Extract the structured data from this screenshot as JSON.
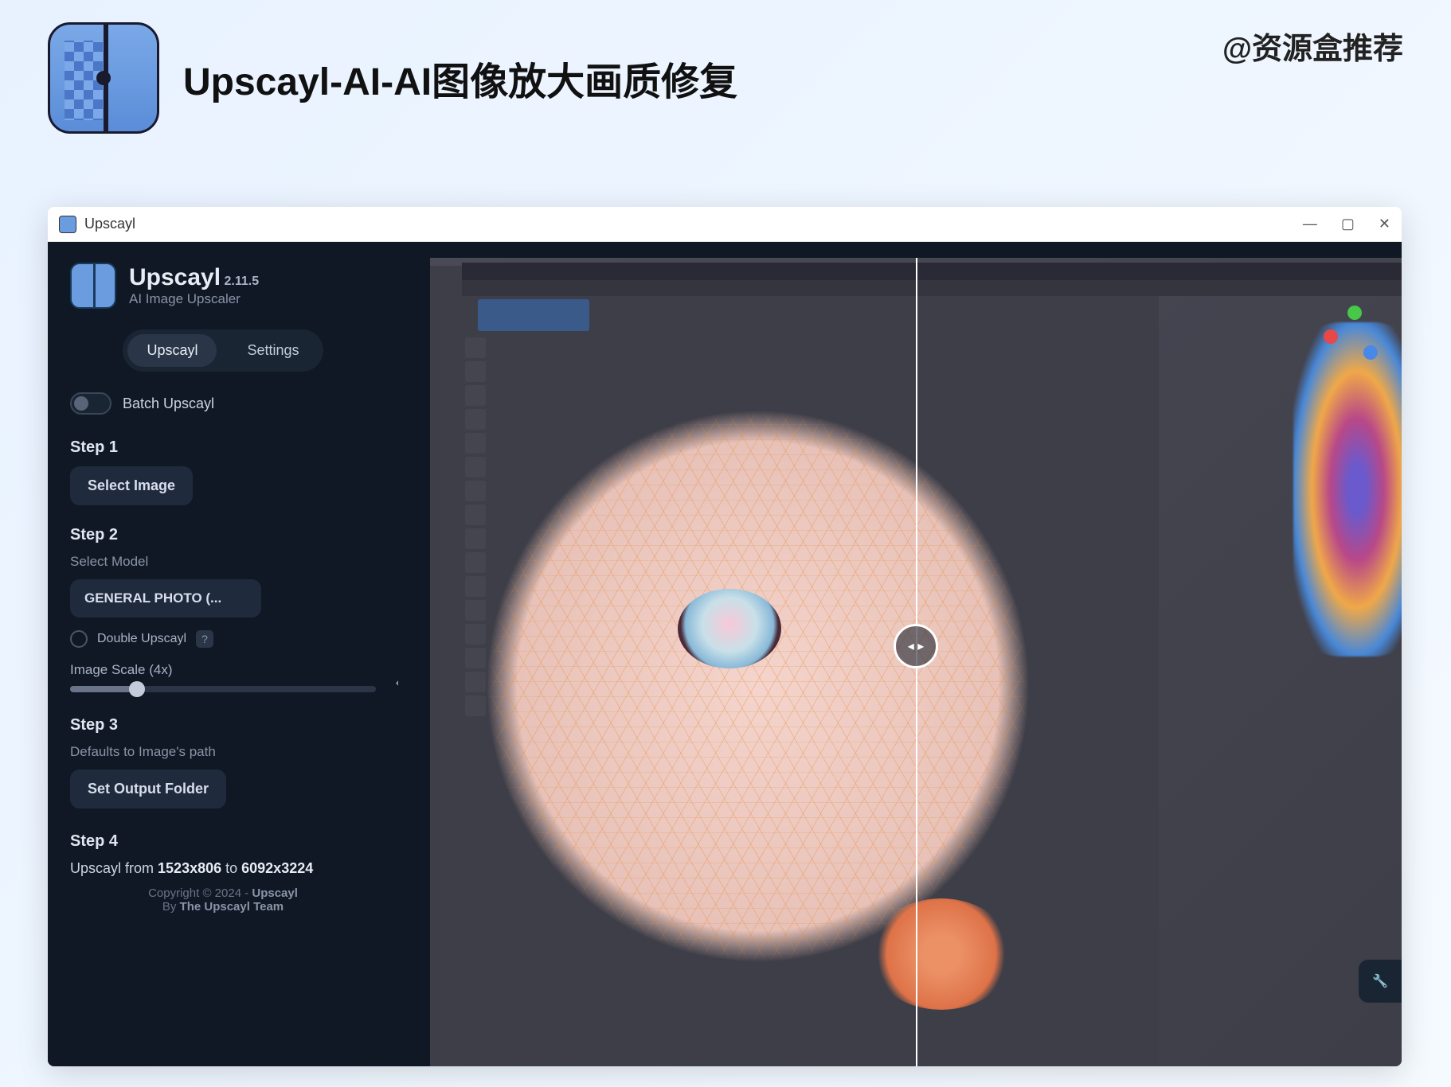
{
  "page": {
    "attribution": "@资源盒推荐",
    "title": "Upscayl-AI-AI图像放大画质修复"
  },
  "window": {
    "title": "Upscayl",
    "controls": {
      "minimize": "—",
      "maximize": "▢",
      "close": "✕"
    }
  },
  "brand": {
    "name": "Upscayl",
    "version": "2.11.5",
    "subtitle": "AI Image Upscaler"
  },
  "tabs": {
    "upscayl": "Upscayl",
    "settings": "Settings"
  },
  "batch": {
    "label": "Batch Upscayl"
  },
  "step1": {
    "label": "Step 1",
    "button": "Select Image"
  },
  "step2": {
    "label": "Step 2",
    "desc": "Select Model",
    "model": "GENERAL PHOTO (...",
    "double": "Double Upscayl",
    "help": "?",
    "scale_label": "Image Scale (4x)"
  },
  "step3": {
    "label": "Step 3",
    "desc": "Defaults to Image's path",
    "button": "Set Output Folder"
  },
  "step4": {
    "label": "Step 4",
    "prefix": "Upscayl from ",
    "from": "1523x806",
    "mid": " to ",
    "to": "6092x3224"
  },
  "credits": {
    "line1a": "Copyright © 2024 - ",
    "line1b": "Upscayl",
    "line2a": "By ",
    "line2b": "The Upscayl Team"
  },
  "viewer": {
    "collapse": "‹",
    "compare": "◂ ▸",
    "wrench": "🔧"
  }
}
